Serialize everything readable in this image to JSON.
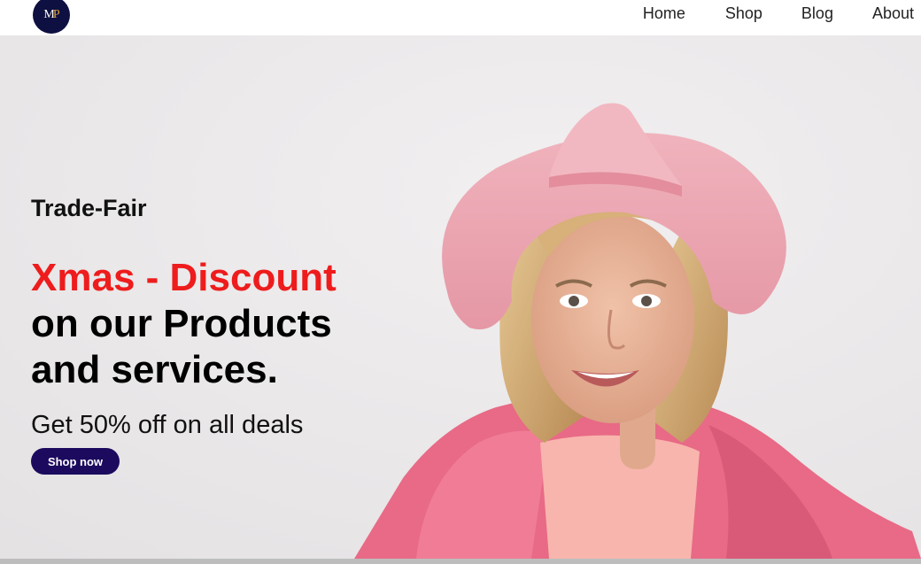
{
  "brand": {
    "logo_letters": {
      "m": "M",
      "p": "P"
    }
  },
  "nav": {
    "items": [
      {
        "label": "Home"
      },
      {
        "label": "Shop"
      },
      {
        "label": "Blog"
      },
      {
        "label": "About"
      }
    ]
  },
  "hero": {
    "subtitle": "Trade-Fair",
    "headline_highlight": "Xmas - Discount",
    "headline_line2": "on our Products",
    "headline_line3": "and services.",
    "offer": "Get 50% off on all deals",
    "cta_label": "Shop now"
  },
  "colors": {
    "accent_red": "#ee1c1c",
    "button_bg": "#1c0a5e",
    "logo_bg": "#0d1040",
    "hero_bg": "#e9e7e8"
  },
  "image": {
    "subject": "woman-in-pink-hat-and-coat"
  }
}
